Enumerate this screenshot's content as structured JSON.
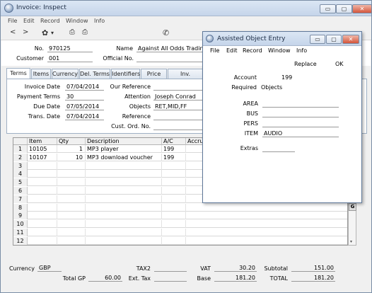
{
  "main": {
    "title": "Invoice: Inspect",
    "menu": [
      "File",
      "Edit",
      "Record",
      "Window",
      "Info"
    ],
    "toolbar": {
      "prev": "<",
      "next": ">",
      "gear": "✿",
      "gear_arrow": "▾",
      "print": "⎙",
      "preview": "⎙",
      "phone": "✆"
    },
    "header": {
      "no_label": "No.",
      "no_value": "970125",
      "name_label": "Name",
      "name_value": "Against All Odds Trading Co",
      "customer_label": "Customer",
      "customer_value": "001",
      "official_label": "Official No."
    },
    "tabs": [
      "Terms",
      "Items",
      "Currency",
      "Del. Terms",
      "Identifiers",
      "Price List",
      "Inv. Address"
    ],
    "terms": {
      "invoice_date_label": "Invoice Date",
      "invoice_date": "07/04/2014",
      "payment_terms_label": "Payment Terms",
      "payment_terms": "30",
      "due_date_label": "Due Date",
      "due_date": "07/05/2014",
      "trans_date_label": "Trans. Date",
      "trans_date": "07/04/2014",
      "our_ref_label": "Our Reference",
      "our_ref": "",
      "attention_label": "Attention",
      "attention": "Joseph Conrad",
      "objects_label": "Objects",
      "objects": "RET,MID,FF",
      "reference_label": "Reference",
      "reference": "",
      "cust_ord_label": "Cust. Ord. No.",
      "cust_ord": ""
    },
    "grid": {
      "headers": [
        "Item",
        "Qty",
        "Description",
        "A/C",
        "Accrua"
      ],
      "rows": [
        {
          "num": "1",
          "item": "10105",
          "qty": "1",
          "desc": "MP3 player",
          "ac": "199"
        },
        {
          "num": "2",
          "item": "10107",
          "qty": "10",
          "desc": "MP3 download voucher",
          "ac": "199"
        },
        {
          "num": "3"
        },
        {
          "num": "4"
        },
        {
          "num": "5"
        },
        {
          "num": "6"
        },
        {
          "num": "7"
        },
        {
          "num": "8"
        },
        {
          "num": "9"
        },
        {
          "num": "10"
        },
        {
          "num": "11"
        },
        {
          "num": "12"
        }
      ],
      "side_button": "G"
    },
    "footer": {
      "currency_label": "Currency",
      "currency": "GBP",
      "tax2_label": "TAX2",
      "tax2": "",
      "vat_label": "VAT",
      "vat": "30.20",
      "subtotal_label": "Subtotal",
      "subtotal": "151.00",
      "total_gp_label": "Total GP",
      "total_gp": "60.00",
      "ext_tax_label": "Ext. Tax",
      "ext_tax": "",
      "base_label": "Base",
      "base": "181.20",
      "total_label": "TOTAL",
      "total": "181.20"
    }
  },
  "dialog": {
    "title": "Assisted Object Entry",
    "menu": [
      "File",
      "Edit",
      "Record",
      "Window",
      "Info"
    ],
    "replace": "Replace",
    "ok": "OK",
    "account_label": "Account",
    "account": "199",
    "required_label": "Required",
    "required": "Objects",
    "fields": [
      {
        "label": "AREA",
        "value": ""
      },
      {
        "label": "BUS",
        "value": ""
      },
      {
        "label": "PERS",
        "value": ""
      },
      {
        "label": "ITEM",
        "value": "AUDIO"
      }
    ],
    "extras_label": "Extras",
    "extras": ""
  },
  "window_buttons": {
    "minimize": "▭",
    "maximize": "▢",
    "close": "✕"
  }
}
